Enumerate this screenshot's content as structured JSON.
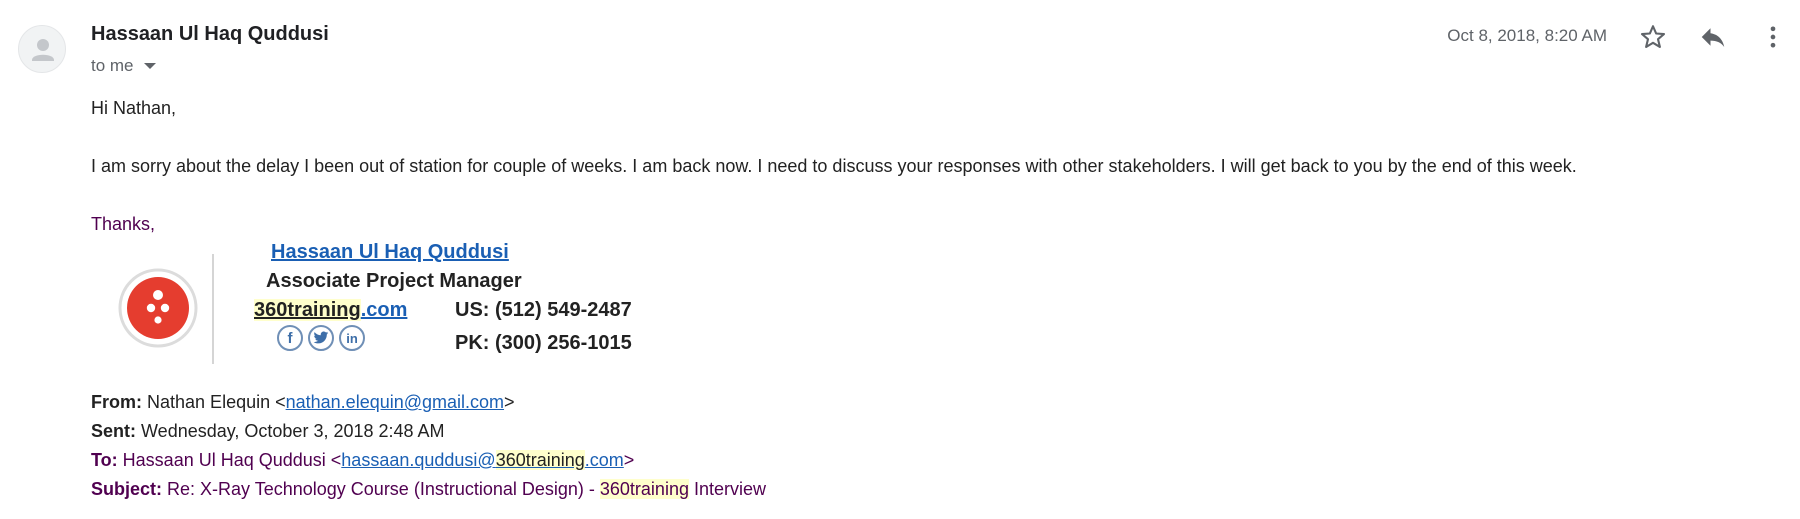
{
  "header": {
    "sender_name": "Hassaan Ul Haq Quddusi",
    "recipient_line": "to me",
    "date": "Oct 8, 2018, 8:20 AM",
    "icons": {
      "avatar": "person-icon",
      "star": "star-icon",
      "reply": "reply-icon",
      "more": "more-vert-icon"
    }
  },
  "body": {
    "greeting": "Hi Nathan,",
    "paragraph": "I am sorry about the delay I been out of station for couple of weeks. I am back now. I need to discuss your responses with other stakeholders. I will get back to you by the end of this week.",
    "closing": "Thanks,"
  },
  "signature": {
    "name": "Hassaan Ul Haq Quddusi",
    "title": "Associate Project Manager",
    "website_highlight": "360training",
    "website_rest": ".com",
    "phone_us": "US: (512) 549-2487",
    "phone_pk": "PK: (300) 256-1015",
    "social": {
      "facebook": "f",
      "twitter": "twitter-icon",
      "linkedin": "in"
    },
    "colors": {
      "logo_red": "#e53d2f",
      "link_blue": "#1a5fb4"
    }
  },
  "quoted": {
    "from_label": "From:",
    "from_name": "Nathan Elequin <",
    "from_email": "nathan.elequin@gmail.com",
    "from_close": ">",
    "sent_label": "Sent:",
    "sent_value": "Wednesday, October 3, 2018 2:48 AM",
    "to_label": "To:",
    "to_name": "Hassaan Ul Haq Quddusi <",
    "to_email_user": "hassaan.quddusi@",
    "to_email_highlight": "360training",
    "to_email_domain": ".com",
    "to_close": ">",
    "subject_label": "Subject:",
    "subject_prefix": "Re: X-Ray Technology Course (Instructional Design) - ",
    "subject_highlight": "360training",
    "subject_suffix": " Interview"
  }
}
